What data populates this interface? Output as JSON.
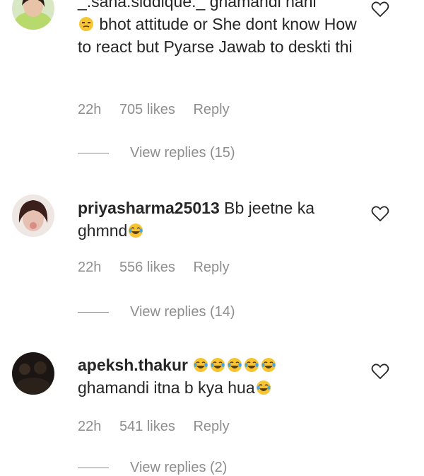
{
  "comments": [
    {
      "username": "_.sana.siddique._",
      "text_line1": "ghamandi nahi",
      "text_rest": "bhot attitude or She dont know How to react but Pyarse Jawab to deskti thi",
      "time": "22h",
      "likes": "705 likes",
      "reply": "Reply",
      "view_replies": "View replies (15)",
      "avatar_icon": "profile-photo"
    },
    {
      "username": "priyasharma25013",
      "text": "Bb jeetne ka ghmnd",
      "time": "22h",
      "likes": "556 likes",
      "reply": "Reply",
      "view_replies": "View replies (14)",
      "avatar_icon": "profile-photo"
    },
    {
      "username": "apeksh.thakur",
      "text": "ghamandi itna b kya hua",
      "time": "22h",
      "likes": "541 likes",
      "reply": "Reply",
      "view_replies": "View replies (2)",
      "avatar_icon": "profile-photo"
    }
  ],
  "icons": {
    "like": "heart-outline-icon",
    "emoji_neutral": "unamused-face-emoji",
    "emoji_laugh": "laughing-tears-emoji"
  },
  "colors": {
    "text": "#262626",
    "secondary": "#8e8e8e",
    "emoji_yellow": "#f7c531"
  }
}
